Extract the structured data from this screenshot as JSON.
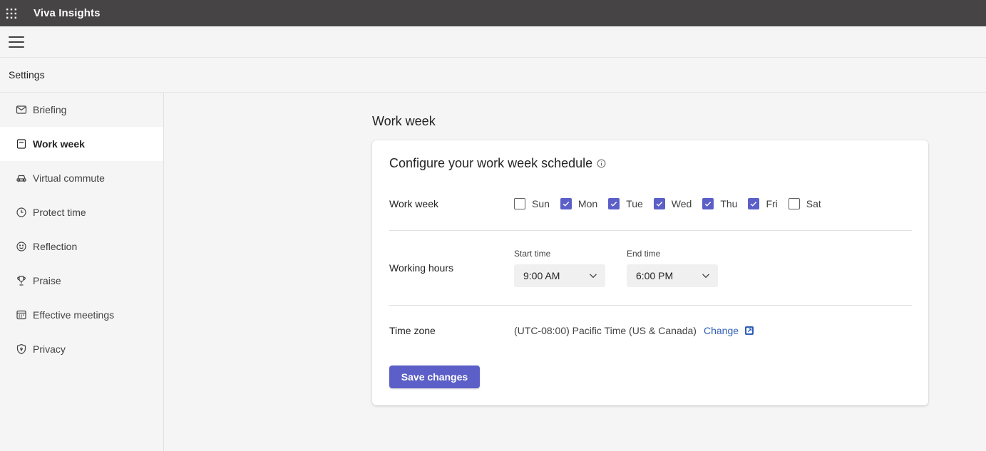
{
  "app": {
    "title": "Viva Insights"
  },
  "breadcrumb": {
    "label": "Settings"
  },
  "sidebar": {
    "items": [
      {
        "label": "Briefing",
        "icon": "mail-icon"
      },
      {
        "label": "Work week",
        "icon": "calendar-page-icon",
        "active": true
      },
      {
        "label": "Virtual commute",
        "icon": "car-icon"
      },
      {
        "label": "Protect time",
        "icon": "clock-icon"
      },
      {
        "label": "Reflection",
        "icon": "smile-icon"
      },
      {
        "label": "Praise",
        "icon": "trophy-icon"
      },
      {
        "label": "Effective meetings",
        "icon": "calendar-grid-icon"
      },
      {
        "label": "Privacy",
        "icon": "shield-icon"
      }
    ]
  },
  "main": {
    "heading": "Work week",
    "card": {
      "title": "Configure your work week schedule",
      "work_week": {
        "label": "Work week",
        "days": [
          {
            "label": "Sun",
            "checked": false
          },
          {
            "label": "Mon",
            "checked": true
          },
          {
            "label": "Tue",
            "checked": true
          },
          {
            "label": "Wed",
            "checked": true
          },
          {
            "label": "Thu",
            "checked": true
          },
          {
            "label": "Fri",
            "checked": true
          },
          {
            "label": "Sat",
            "checked": false
          }
        ]
      },
      "working_hours": {
        "label": "Working hours",
        "start_caption": "Start time",
        "start_value": "9:00 AM",
        "end_caption": "End time",
        "end_value": "6:00 PM"
      },
      "time_zone": {
        "label": "Time zone",
        "value": "(UTC-08:00) Pacific Time (US & Canada)",
        "change_label": "Change"
      },
      "save_label": "Save changes"
    }
  },
  "colors": {
    "accent": "#5b5fc7",
    "topbar": "#464444",
    "link": "#2f5eb5"
  }
}
